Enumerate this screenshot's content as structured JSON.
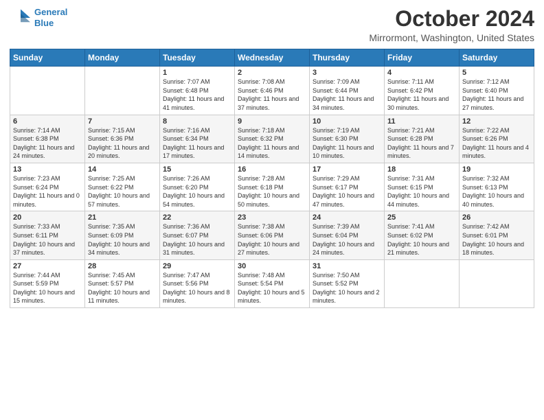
{
  "logo": {
    "line1": "General",
    "line2": "Blue"
  },
  "title": "October 2024",
  "location": "Mirrormont, Washington, United States",
  "days_of_week": [
    "Sunday",
    "Monday",
    "Tuesday",
    "Wednesday",
    "Thursday",
    "Friday",
    "Saturday"
  ],
  "weeks": [
    [
      {
        "day": "",
        "sunrise": "",
        "sunset": "",
        "daylight": ""
      },
      {
        "day": "",
        "sunrise": "",
        "sunset": "",
        "daylight": ""
      },
      {
        "day": "1",
        "sunrise": "Sunrise: 7:07 AM",
        "sunset": "Sunset: 6:48 PM",
        "daylight": "Daylight: 11 hours and 41 minutes."
      },
      {
        "day": "2",
        "sunrise": "Sunrise: 7:08 AM",
        "sunset": "Sunset: 6:46 PM",
        "daylight": "Daylight: 11 hours and 37 minutes."
      },
      {
        "day": "3",
        "sunrise": "Sunrise: 7:09 AM",
        "sunset": "Sunset: 6:44 PM",
        "daylight": "Daylight: 11 hours and 34 minutes."
      },
      {
        "day": "4",
        "sunrise": "Sunrise: 7:11 AM",
        "sunset": "Sunset: 6:42 PM",
        "daylight": "Daylight: 11 hours and 30 minutes."
      },
      {
        "day": "5",
        "sunrise": "Sunrise: 7:12 AM",
        "sunset": "Sunset: 6:40 PM",
        "daylight": "Daylight: 11 hours and 27 minutes."
      }
    ],
    [
      {
        "day": "6",
        "sunrise": "Sunrise: 7:14 AM",
        "sunset": "Sunset: 6:38 PM",
        "daylight": "Daylight: 11 hours and 24 minutes."
      },
      {
        "day": "7",
        "sunrise": "Sunrise: 7:15 AM",
        "sunset": "Sunset: 6:36 PM",
        "daylight": "Daylight: 11 hours and 20 minutes."
      },
      {
        "day": "8",
        "sunrise": "Sunrise: 7:16 AM",
        "sunset": "Sunset: 6:34 PM",
        "daylight": "Daylight: 11 hours and 17 minutes."
      },
      {
        "day": "9",
        "sunrise": "Sunrise: 7:18 AM",
        "sunset": "Sunset: 6:32 PM",
        "daylight": "Daylight: 11 hours and 14 minutes."
      },
      {
        "day": "10",
        "sunrise": "Sunrise: 7:19 AM",
        "sunset": "Sunset: 6:30 PM",
        "daylight": "Daylight: 11 hours and 10 minutes."
      },
      {
        "day": "11",
        "sunrise": "Sunrise: 7:21 AM",
        "sunset": "Sunset: 6:28 PM",
        "daylight": "Daylight: 11 hours and 7 minutes."
      },
      {
        "day": "12",
        "sunrise": "Sunrise: 7:22 AM",
        "sunset": "Sunset: 6:26 PM",
        "daylight": "Daylight: 11 hours and 4 minutes."
      }
    ],
    [
      {
        "day": "13",
        "sunrise": "Sunrise: 7:23 AM",
        "sunset": "Sunset: 6:24 PM",
        "daylight": "Daylight: 11 hours and 0 minutes."
      },
      {
        "day": "14",
        "sunrise": "Sunrise: 7:25 AM",
        "sunset": "Sunset: 6:22 PM",
        "daylight": "Daylight: 10 hours and 57 minutes."
      },
      {
        "day": "15",
        "sunrise": "Sunrise: 7:26 AM",
        "sunset": "Sunset: 6:20 PM",
        "daylight": "Daylight: 10 hours and 54 minutes."
      },
      {
        "day": "16",
        "sunrise": "Sunrise: 7:28 AM",
        "sunset": "Sunset: 6:18 PM",
        "daylight": "Daylight: 10 hours and 50 minutes."
      },
      {
        "day": "17",
        "sunrise": "Sunrise: 7:29 AM",
        "sunset": "Sunset: 6:17 PM",
        "daylight": "Daylight: 10 hours and 47 minutes."
      },
      {
        "day": "18",
        "sunrise": "Sunrise: 7:31 AM",
        "sunset": "Sunset: 6:15 PM",
        "daylight": "Daylight: 10 hours and 44 minutes."
      },
      {
        "day": "19",
        "sunrise": "Sunrise: 7:32 AM",
        "sunset": "Sunset: 6:13 PM",
        "daylight": "Daylight: 10 hours and 40 minutes."
      }
    ],
    [
      {
        "day": "20",
        "sunrise": "Sunrise: 7:33 AM",
        "sunset": "Sunset: 6:11 PM",
        "daylight": "Daylight: 10 hours and 37 minutes."
      },
      {
        "day": "21",
        "sunrise": "Sunrise: 7:35 AM",
        "sunset": "Sunset: 6:09 PM",
        "daylight": "Daylight: 10 hours and 34 minutes."
      },
      {
        "day": "22",
        "sunrise": "Sunrise: 7:36 AM",
        "sunset": "Sunset: 6:07 PM",
        "daylight": "Daylight: 10 hours and 31 minutes."
      },
      {
        "day": "23",
        "sunrise": "Sunrise: 7:38 AM",
        "sunset": "Sunset: 6:06 PM",
        "daylight": "Daylight: 10 hours and 27 minutes."
      },
      {
        "day": "24",
        "sunrise": "Sunrise: 7:39 AM",
        "sunset": "Sunset: 6:04 PM",
        "daylight": "Daylight: 10 hours and 24 minutes."
      },
      {
        "day": "25",
        "sunrise": "Sunrise: 7:41 AM",
        "sunset": "Sunset: 6:02 PM",
        "daylight": "Daylight: 10 hours and 21 minutes."
      },
      {
        "day": "26",
        "sunrise": "Sunrise: 7:42 AM",
        "sunset": "Sunset: 6:01 PM",
        "daylight": "Daylight: 10 hours and 18 minutes."
      }
    ],
    [
      {
        "day": "27",
        "sunrise": "Sunrise: 7:44 AM",
        "sunset": "Sunset: 5:59 PM",
        "daylight": "Daylight: 10 hours and 15 minutes."
      },
      {
        "day": "28",
        "sunrise": "Sunrise: 7:45 AM",
        "sunset": "Sunset: 5:57 PM",
        "daylight": "Daylight: 10 hours and 11 minutes."
      },
      {
        "day": "29",
        "sunrise": "Sunrise: 7:47 AM",
        "sunset": "Sunset: 5:56 PM",
        "daylight": "Daylight: 10 hours and 8 minutes."
      },
      {
        "day": "30",
        "sunrise": "Sunrise: 7:48 AM",
        "sunset": "Sunset: 5:54 PM",
        "daylight": "Daylight: 10 hours and 5 minutes."
      },
      {
        "day": "31",
        "sunrise": "Sunrise: 7:50 AM",
        "sunset": "Sunset: 5:52 PM",
        "daylight": "Daylight: 10 hours and 2 minutes."
      },
      {
        "day": "",
        "sunrise": "",
        "sunset": "",
        "daylight": ""
      },
      {
        "day": "",
        "sunrise": "",
        "sunset": "",
        "daylight": ""
      }
    ]
  ]
}
